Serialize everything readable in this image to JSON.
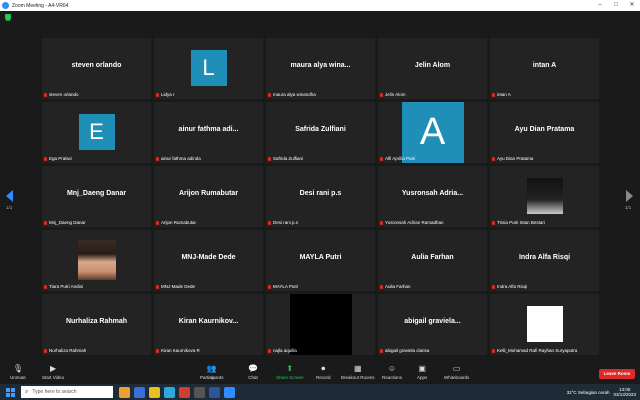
{
  "window": {
    "title": "Zoom Meeting - A4-VR64"
  },
  "nav": {
    "left_page": "1/1",
    "right_page": "1/1"
  },
  "tiles": [
    {
      "name": "steven orlando",
      "label": "steven orlando",
      "kind": "name"
    },
    {
      "name": "",
      "label": "Lidya r",
      "kind": "avatar",
      "letter": "L"
    },
    {
      "name": "maura alya wina...",
      "label": "maura alya winandha",
      "kind": "name"
    },
    {
      "name": "Jelin Alom",
      "label": "Jelin Alom",
      "kind": "name"
    },
    {
      "name": "intan A",
      "label": "intan A",
      "kind": "name"
    },
    {
      "name": "",
      "label": "Ega Pratiwi",
      "kind": "avatar",
      "letter": "E"
    },
    {
      "name": "ainur fathma adi...",
      "label": "ainur fathma adinda",
      "kind": "name"
    },
    {
      "name": "Safrida Zulfiani",
      "label": "Safrida Zulfiani",
      "kind": "name"
    },
    {
      "name": "",
      "label": "Alfi Aprilia Putri",
      "kind": "avatar-big",
      "letter": "A"
    },
    {
      "name": "Ayu Dian Pratama",
      "label": "Ayu Dian Pratama",
      "kind": "name"
    },
    {
      "name": "Mnj_Daeng Danar",
      "label": "Mnj_Daeng Danar",
      "kind": "name"
    },
    {
      "name": "Arijon Rumabutar",
      "label": "Arijon Rumabutar",
      "kind": "name"
    },
    {
      "name": "Desi rani p.s",
      "label": "Desi rani p.s",
      "kind": "name"
    },
    {
      "name": "Yusronsah  Adria...",
      "label": "Yusronsah Adrian Ramadhan",
      "kind": "name"
    },
    {
      "name": "",
      "label": "Trisia Putri Intan Bestari",
      "kind": "landscape"
    },
    {
      "name": "",
      "label": "Tiara Putri Andini",
      "kind": "girl"
    },
    {
      "name": "MNJ-Made Dede",
      "label": "MNJ-Made Dede",
      "kind": "name"
    },
    {
      "name": "MAYLA Putri",
      "label": "MAYLA Putri",
      "kind": "name"
    },
    {
      "name": "Aulia Farhan",
      "label": "Aulia Farhan",
      "kind": "name"
    },
    {
      "name": "Indra Alfa Risqi",
      "label": "Indra Alfa Risqi",
      "kind": "name"
    },
    {
      "name": "Nurhaliza Rahmah",
      "label": "Nurhaliza Rahmah",
      "kind": "name"
    },
    {
      "name": "Kiran  Kaurnikov...",
      "label": "Kiran Kaurnikova R",
      "kind": "name"
    },
    {
      "name": "",
      "label": "najla aquilla",
      "kind": "black"
    },
    {
      "name": "abigail graviela...",
      "label": "abigail graviela clarisa",
      "kind": "name"
    },
    {
      "name": "",
      "label": "Kelli_Muhamad Rafi Rayhan Suryaputra",
      "kind": "white"
    }
  ],
  "toolbar": {
    "unmute": "Unmute",
    "start_video": "Start Video",
    "participants": "Participants",
    "participants_count": "52",
    "chat": "Chat",
    "share_screen": "Share Screen",
    "record": "Record",
    "breakout": "Breakout Rooms",
    "reactions": "Reactions",
    "apps": "Apps",
    "whiteboards": "Whiteboards",
    "leave": "Leave Room"
  },
  "taskbar": {
    "search_placeholder": "Type here to search",
    "weather": "32°C  Sebagian cerah",
    "time": "13:05",
    "date": "03/13/2023"
  },
  "colors": {
    "accent": "#2d8cff",
    "leave": "#e02828",
    "share": "#23c552",
    "avatar": "#1f8fb8"
  }
}
